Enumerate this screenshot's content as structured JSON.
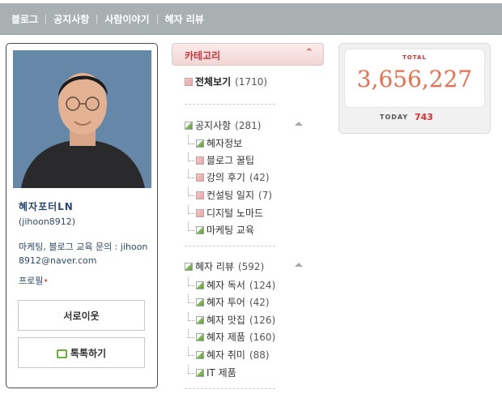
{
  "nav": {
    "items": [
      "블로그",
      "공지사항",
      "사람이야기",
      "혜자 리뷰"
    ]
  },
  "profile": {
    "nickname": "혜자포터LN",
    "user_id": "(jihoon8912)",
    "description": "마케팅, 블로그 교육 문의 : jihoon8912@naver.com",
    "profile_link": "프로필",
    "neighbor_button": "서로이웃",
    "talk_button": "톡톡하기"
  },
  "category": {
    "header": "카테고리",
    "all": {
      "label": "전체보기",
      "count": "(1710)"
    },
    "groups": [
      {
        "label": "공지사항",
        "count": "(281)",
        "items": [
          {
            "label": "혜자정보",
            "count": "",
            "icon": "green"
          },
          {
            "label": "블로그 꿀팁",
            "count": "",
            "icon": "red"
          },
          {
            "label": "강의 후기",
            "count": "(42)",
            "icon": "red"
          },
          {
            "label": "컨설팅 일지",
            "count": "(7)",
            "icon": "red"
          },
          {
            "label": "디지털 노마드",
            "count": "",
            "icon": "red"
          },
          {
            "label": "마케팅 교육",
            "count": "",
            "icon": "green"
          }
        ]
      },
      {
        "label": "혜자 리뷰",
        "count": "(592)",
        "items": [
          {
            "label": "혜자 독서",
            "count": "(124)",
            "icon": "green"
          },
          {
            "label": "혜자 투어",
            "count": "(42)",
            "icon": "green"
          },
          {
            "label": "혜자 맛집",
            "count": "(126)",
            "icon": "green"
          },
          {
            "label": "혜자 제품",
            "count": "(160)",
            "icon": "green"
          },
          {
            "label": "혜자 취미",
            "count": "(88)",
            "icon": "green"
          },
          {
            "label": "IT 제품",
            "count": "",
            "icon": "green"
          }
        ]
      }
    ]
  },
  "counter": {
    "total_label": "TOTAL",
    "total": "3,656,227",
    "today_label": "TODAY",
    "today": "743"
  },
  "colors": {
    "accent_red": "#d9302a",
    "nav_bg": "#a8b0b2",
    "link_blue": "#2b4a6f"
  }
}
